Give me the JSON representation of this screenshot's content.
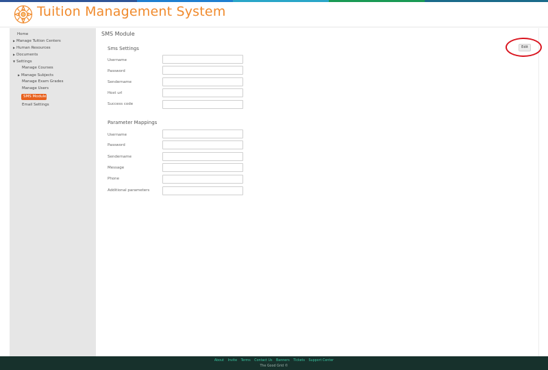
{
  "app": {
    "title": "Tuition Management System",
    "accent_color": "#f08a2c",
    "logo_icon": "gear-flower-logo"
  },
  "sidebar": {
    "items": [
      {
        "label": "Home",
        "expandable": false
      },
      {
        "label": "Manage Tuition Centers",
        "expandable": true,
        "expanded": false
      },
      {
        "label": "Human Resources",
        "expandable": true,
        "expanded": false
      },
      {
        "label": "Documents",
        "expandable": true,
        "expanded": false
      },
      {
        "label": "Settings",
        "expandable": true,
        "expanded": true
      },
      {
        "label": "Manage Courses",
        "sub": true
      },
      {
        "label": "Manage Subjects",
        "sub": true,
        "expandable": true
      },
      {
        "label": "Manage Exam Grades",
        "sub": true
      },
      {
        "label": "Manage Users",
        "sub": true
      },
      {
        "label": "SMS Module",
        "sub": true,
        "active": true
      },
      {
        "label": "Email Settings",
        "sub": true
      }
    ],
    "active_color": "#e8611d"
  },
  "main": {
    "module_title": "SMS Module",
    "edit_label": "Edit",
    "sms_settings": {
      "title": "Sms Settings",
      "fields": [
        {
          "label": "Username",
          "value": ""
        },
        {
          "label": "Password",
          "value": ""
        },
        {
          "label": "Sendername",
          "value": ""
        },
        {
          "label": "Host url",
          "value": ""
        },
        {
          "label": "Success code",
          "value": ""
        }
      ]
    },
    "parameter_mappings": {
      "title": "Parameter Mappings",
      "fields": [
        {
          "label": "Username",
          "value": ""
        },
        {
          "label": "Password",
          "value": ""
        },
        {
          "label": "Sendername",
          "value": ""
        },
        {
          "label": "Message",
          "value": ""
        },
        {
          "label": "Phone",
          "value": ""
        },
        {
          "label": "Additional parameters",
          "value": ""
        }
      ]
    }
  },
  "footer": {
    "links": [
      "About",
      "Invite",
      "Terms",
      "Contact Us",
      "Banners",
      "Tickets",
      "Support Center"
    ],
    "copyright": "The Good Grid ©",
    "background": "#17312c",
    "link_color": "#39c5a0"
  },
  "annotation": {
    "color": "#d9141e"
  }
}
